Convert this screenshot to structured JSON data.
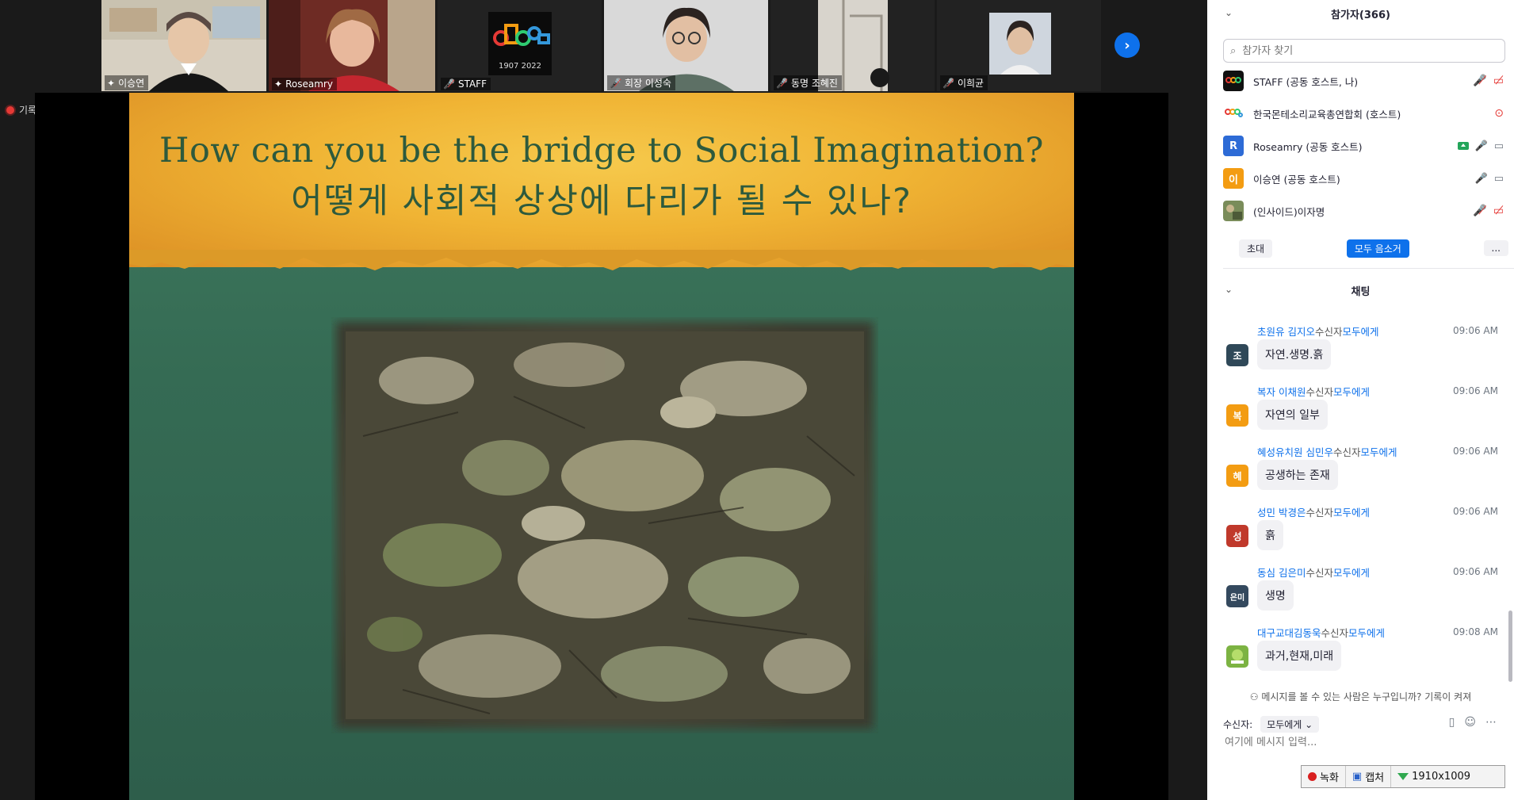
{
  "thumbnails": [
    {
      "name": "이승연",
      "role_icon": "host-pin-icon",
      "mic_muted": false
    },
    {
      "name": "Roseamry",
      "role_icon": "host-pin-icon",
      "mic_muted": false,
      "speaking": true
    },
    {
      "name": "STAFF",
      "role_icon": "",
      "mic_muted": true
    },
    {
      "name": "회장 이성숙",
      "role_icon": "",
      "mic_muted": true
    },
    {
      "name": "동명 조혜진",
      "role_icon": "",
      "mic_muted": true
    },
    {
      "name": "이희균",
      "role_icon": "",
      "mic_muted": true
    }
  ],
  "logo_text": "1907 2022",
  "recording_label": "기록 중",
  "slide": {
    "title": "How can you be the bridge to Social Imagination?",
    "subtitle": "어떻게 사회적 상상에 다리가 될 수 있나?"
  },
  "participants_panel": {
    "header": "참가자(366)",
    "search_placeholder": "참가자 찾기",
    "participants": [
      {
        "name": "STAFF (공동 호스트, 나)",
        "avatar_text": "",
        "avatar_color": "#111111"
      },
      {
        "name": "한국몬테소리교육총연합회 (호스트)",
        "avatar_text": "",
        "avatar_color": "#ffffff"
      },
      {
        "name": "Roseamry (공동 호스트)",
        "avatar_text": "R",
        "avatar_color": "#2d6bd6"
      },
      {
        "name": "이승연 (공동 호스트)",
        "avatar_text": "이",
        "avatar_color": "#f39c12"
      },
      {
        "name": "(인사이드)이자명",
        "avatar_text": "",
        "avatar_color": "#7a8c5a"
      }
    ],
    "invite_label": "초대",
    "mute_all_label": "모두 음소거",
    "more_label": "..."
  },
  "chat_panel": {
    "header": "채팅",
    "messages": [
      {
        "sender": "초원유 김지오",
        "mid": "수신자",
        "to": "모두에게",
        "time": "09:06 AM",
        "text": "자연.생명.흙",
        "avatar_text": "조",
        "avatar_color": "#2f4858"
      },
      {
        "sender": "복자 이채원",
        "mid": "수신자",
        "to": "모두에게",
        "time": "09:06 AM",
        "text": "자연의 일부",
        "avatar_text": "복",
        "avatar_color": "#f39c12"
      },
      {
        "sender": "혜성유치원 심민우",
        "mid": "수신자",
        "to": "모두에게",
        "time": "09:06 AM",
        "text": "공생하는 존재",
        "avatar_text": "혜",
        "avatar_color": "#f39c12"
      },
      {
        "sender": "성민 박경은",
        "mid": "수신자",
        "to": "모두에게",
        "time": "09:06 AM",
        "text": "흙",
        "avatar_text": "성",
        "avatar_color": "#c0392b"
      },
      {
        "sender": "동심 김은미",
        "mid": "수신자",
        "to": "모두에게",
        "time": "09:06 AM",
        "text": "생명",
        "avatar_text": "은미",
        "avatar_color": "#34495e"
      },
      {
        "sender": "대구교대김동욱",
        "mid": "수신자",
        "to": "모두에게",
        "time": "09:08 AM",
        "text": "과거,현재,미래",
        "avatar_text": "",
        "avatar_color": "#7cb342"
      }
    ],
    "notice": "메시지를 볼 수 있는 사람은 누구입니까? 기록이 켜져",
    "recipient_label": "수신자:",
    "recipient_value": "모두에게",
    "input_placeholder": "여기에 메시지 입력..."
  },
  "status_bar": {
    "record_label": "녹화",
    "capture_label": "캡처",
    "resolution": "1910x1009"
  }
}
